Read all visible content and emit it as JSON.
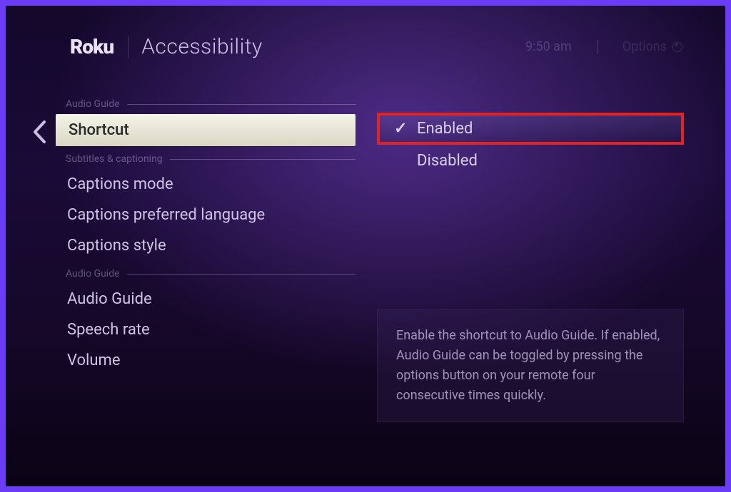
{
  "header": {
    "logo": "Roku",
    "title": "Accessibility",
    "time": "9:50 am",
    "hint_label": "Options"
  },
  "left": {
    "section1_label": "Audio Guide",
    "section2_label": "Subtitles & captioning",
    "section3_label": "Audio Guide",
    "items": {
      "shortcut": "Shortcut",
      "captions_mode": "Captions mode",
      "captions_lang": "Captions preferred language",
      "captions_style": "Captions style",
      "audio_guide": "Audio Guide",
      "speech_rate": "Speech rate",
      "volume": "Volume"
    }
  },
  "right": {
    "enabled_label": "Enabled",
    "disabled_label": "Disabled",
    "check_glyph": "✓"
  },
  "description": "Enable the shortcut to Audio Guide. If enabled, Audio Guide can be toggled by pressing the options button on your remote four consecutive times quickly."
}
